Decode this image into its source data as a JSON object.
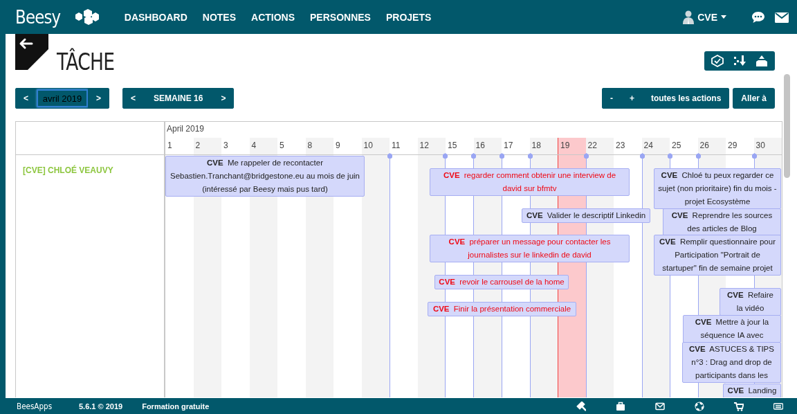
{
  "nav": {
    "logo": "Beesy",
    "items": [
      "DASHBOARD",
      "NOTES",
      "ACTIONS",
      "PERSONNES",
      "PROJETS"
    ],
    "user": "CVE"
  },
  "header": {
    "title": "TÂCHE"
  },
  "toolbar": {
    "month": {
      "prev": "<",
      "value": "avril 2019",
      "next": ">"
    },
    "week": {
      "prev": "<",
      "label": "SEMAINE 16",
      "next": ">"
    },
    "zoom_out": "-",
    "zoom_in": "+",
    "filter": "toutes les actions",
    "goto": "Aller à"
  },
  "timeline": {
    "month_label": "April 2019",
    "days": [
      {
        "label": "1",
        "today": false
      },
      {
        "label": "2",
        "today": false
      },
      {
        "label": "3",
        "today": false
      },
      {
        "label": "4",
        "today": false
      },
      {
        "label": "5",
        "today": false
      },
      {
        "label": "8",
        "today": false
      },
      {
        "label": "9",
        "today": false
      },
      {
        "label": "10",
        "today": false
      },
      {
        "label": "11",
        "today": false
      },
      {
        "label": "12",
        "today": false
      },
      {
        "label": "15",
        "today": false
      },
      {
        "label": "16",
        "today": false
      },
      {
        "label": "17",
        "today": false
      },
      {
        "label": "18",
        "today": false
      },
      {
        "label": "19",
        "today": true
      },
      {
        "label": "22",
        "today": false
      },
      {
        "label": "23",
        "today": false
      },
      {
        "label": "24",
        "today": false
      },
      {
        "label": "25",
        "today": false
      },
      {
        "label": "26",
        "today": false
      },
      {
        "label": "29",
        "today": false
      },
      {
        "label": "30",
        "today": false
      }
    ],
    "person": "[CVE] CHLOÉ VEAUVY",
    "tasks": [
      {
        "owner": "CVE",
        "text": "Me rappeler de recontacter Sebastien.Tranchant@bridgestone.eu au mois de juin (intéressé par Beesy mais pus tard)",
        "late": false
      },
      {
        "owner": "CVE",
        "text": "regarder comment obtenir une interview de david sur bfmtv",
        "late": true
      },
      {
        "owner": "CVE",
        "text": "Valider le descriptif Linkedin",
        "late": false
      },
      {
        "owner": "CVE",
        "text": "préparer un message pour contacter les journalistes sur le linkedin de david",
        "late": true
      },
      {
        "owner": "CVE",
        "text": "revoir le carrousel de la home",
        "late": true
      },
      {
        "owner": "CVE",
        "text": "Finir la présentation commerciale",
        "late": true
      },
      {
        "owner": "CVE",
        "text": "Chloé tu peux regarder ce sujet (non prioritaire) fin du mois - projet Ecosystème",
        "late": false
      },
      {
        "owner": "CVE",
        "text": "Reprendre les sources des articles de Blog",
        "late": false
      },
      {
        "owner": "CVE",
        "text": "Remplir questionnaire pour Participation \"Portrait de startuper\" fin de semaine projet",
        "late": false
      },
      {
        "owner": "CVE",
        "text": "Refaire la vidéo",
        "late": false
      },
      {
        "owner": "CVE",
        "text": "Mettre à jour la séquence IA avec",
        "late": false
      },
      {
        "owner": "CVE",
        "text": "ASTUCES & TIPS n°3 : Drag and drop de participants dans les",
        "late": false
      },
      {
        "owner": "CVE",
        "text": "Landing",
        "late": false
      }
    ]
  },
  "footer": {
    "logo": "BeesApps",
    "version": "5.6.1 © 2019",
    "link": "Formation gratuite"
  }
}
